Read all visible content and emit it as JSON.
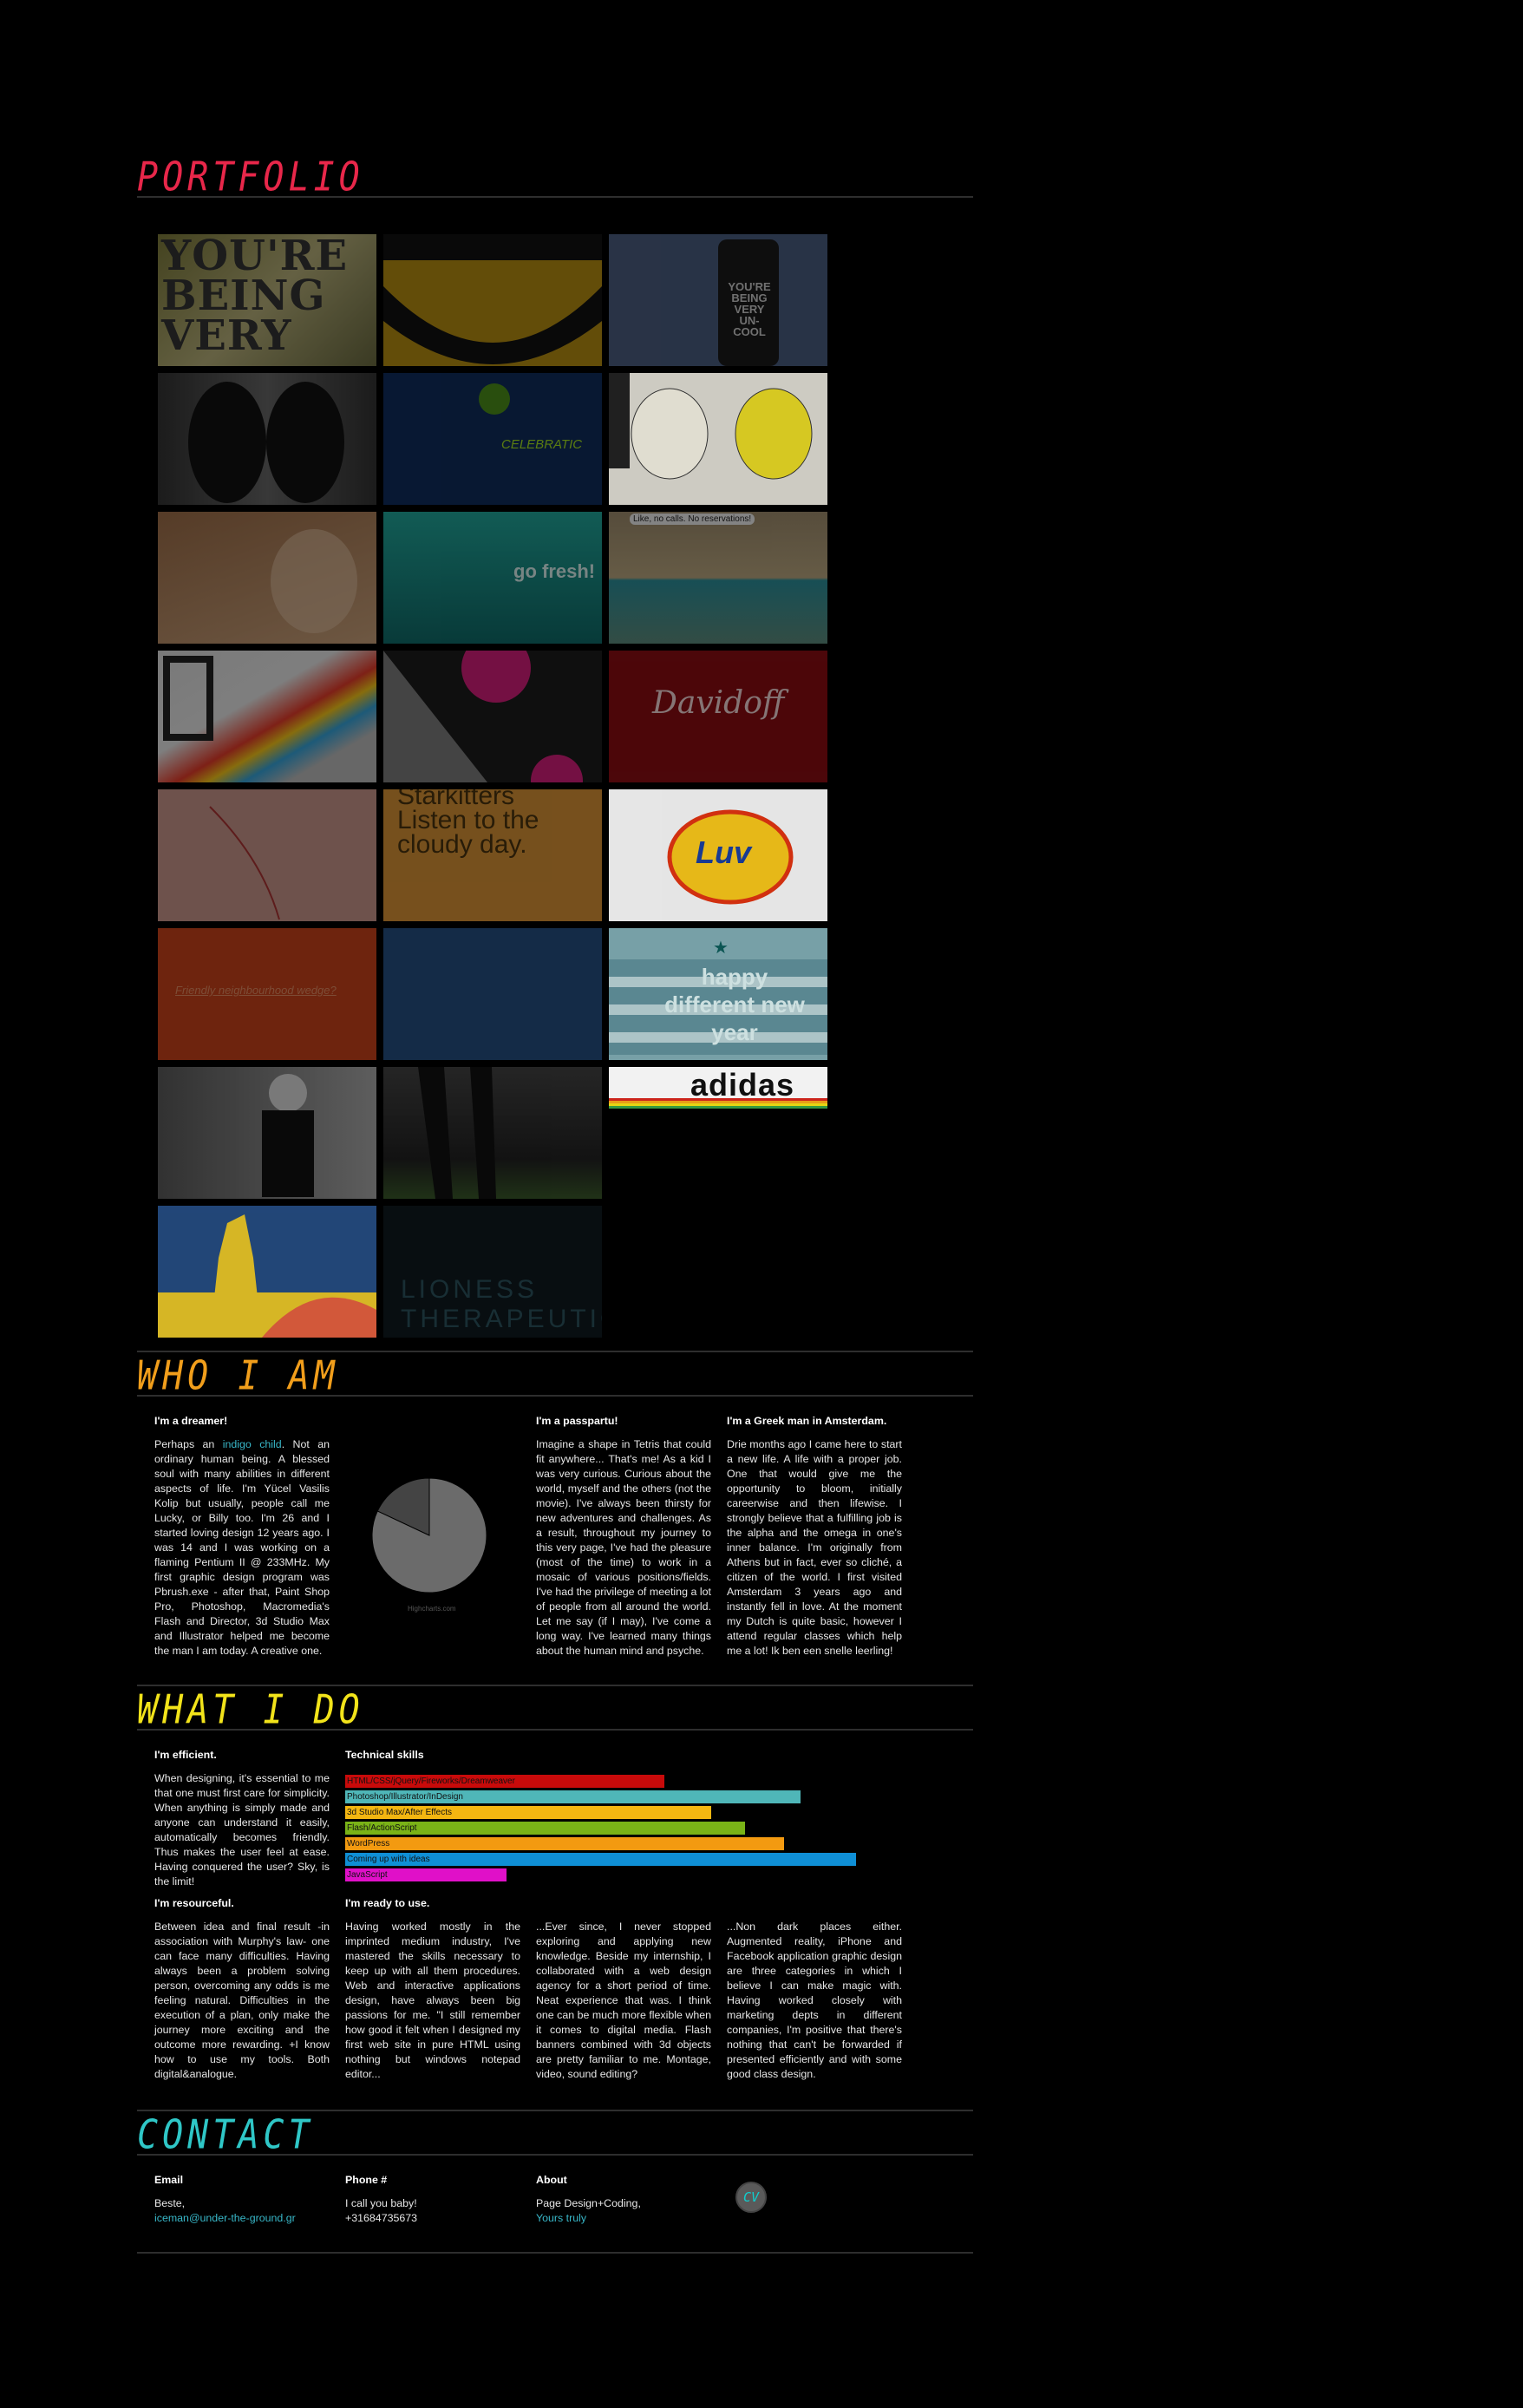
{
  "sections": {
    "portfolio": {
      "title": "PORTFOLIO",
      "color": "#e8274a"
    },
    "who": {
      "title": "WHO I AM",
      "color": "#f19e1b"
    },
    "what": {
      "title": "WHAT I DO",
      "color": "#f2e31a"
    },
    "contact": {
      "title": "CONTACT",
      "color": "#2fc7c7"
    }
  },
  "portfolio_tiles": [
    {
      "caption": "YOU'RE BEING VERY"
    },
    {
      "caption": ""
    },
    {
      "caption": "YOU'RE BEING VERY UN-COOL"
    },
    {
      "caption": ""
    },
    {
      "caption": "CELEBRATIC"
    },
    {
      "caption": ""
    },
    {
      "caption": ""
    },
    {
      "caption": "go fresh!"
    },
    {
      "caption": "Like, no calls. No reservations!"
    },
    {
      "caption": ""
    },
    {
      "caption": ""
    },
    {
      "caption": "Davidoff"
    },
    {
      "caption": ""
    },
    {
      "caption": "Starkitters Listen to the cloudy day."
    },
    {
      "caption": "Luv"
    },
    {
      "caption": "Friendly neighbourhood wedge?"
    },
    {
      "caption": ""
    },
    {
      "caption": "happy different new year"
    },
    {
      "caption": ""
    },
    {
      "caption": ""
    },
    {
      "caption": ""
    },
    {
      "caption": "LIONESS THERAPEUTICS"
    },
    {
      "caption": "adidas"
    }
  ],
  "who": {
    "col1": {
      "heading": "I'm a dreamer!",
      "pre": "Perhaps an ",
      "link": "indigo child",
      "body": ". Not an ordinary human being. A blessed soul with many abilities in different aspects of life. I'm Yücel Vasilis Kolip but usually, people call me Lucky, or Billy too. I'm 26 and I started loving design 12 years ago. I was 14 and I was working on a flaming Pentium II @ 233MHz. My first graphic design program was Pbrush.exe - after that, Paint Shop Pro, Photoshop, Macromedia's Flash and Director, 3d Studio Max and Illustrator helped me become the man I am today. A creative one."
    },
    "chart_credit": "Highcharts.com",
    "col3": {
      "heading": "I'm a passpartu!",
      "body": "Imagine a shape in Tetris that could fit anywhere... That's me! As a kid I was very curious. Curious about the world, myself and the others (not the movie). I've always been thirsty for new adventures and challenges. As a result, throughout my journey to this very page, I've had the pleasure (most of the time) to work in a mosaic of various positions/fields. I've had the privilege of meeting a lot of people from all around the world. Let me say (if I may), I've come a long way. I've learned many things about the human mind and psyche."
    },
    "col4": {
      "heading": "I'm a Greek man in Amsterdam.",
      "body": "Drie months ago I came here to start a new life. A life with a proper job. One that would give me the opportunity to bloom, initially careerwise and then lifewise. I strongly believe that a fulfilling job is the alpha and the omega in one's inner balance. I'm originally from Athens but in fact, ever so cliché, a citizen of the world. I first visited Amsterdam 3 years ago and instantly fell in love. At the moment my Dutch is quite basic, however I attend regular classes which help me a lot! Ik ben een snelle leerling!"
    }
  },
  "chart_data": {
    "type": "pie",
    "title": "",
    "slices": [
      {
        "name": "",
        "value": 82,
        "color": "#6b6b6b"
      },
      {
        "name": "",
        "value": 18,
        "color": "#444444"
      }
    ]
  },
  "what": {
    "efficient": {
      "heading": "I'm efficient.",
      "body": "When designing, it's essential to me that one must first care for simplicity. When anything is simply made and anyone can understand it easily, automatically becomes friendly. Thus makes the user feel at ease. Having conquered the user? Sky, is the limit!"
    },
    "skills_heading": "Technical skills",
    "skills": [
      {
        "label": "HTML/CSS/jQuery/Fireworks/Dreamweaver",
        "level": 0.575,
        "color": "#c80a0a"
      },
      {
        "label": "Photoshop/Illustrator/InDesign",
        "level": 0.82,
        "color": "#4fb6b8"
      },
      {
        "label": "3d Studio Max/After Effects",
        "level": 0.66,
        "color": "#f3b611"
      },
      {
        "label": "Flash/ActionScript",
        "level": 0.72,
        "color": "#7ab317"
      },
      {
        "label": "WordPress",
        "level": 0.79,
        "color": "#f39a10"
      },
      {
        "label": "Coming up with ideas",
        "level": 0.92,
        "color": "#0f8fd6"
      },
      {
        "label": "JavaScript",
        "level": 0.29,
        "color": "#e010c8"
      }
    ],
    "resourceful": {
      "heading": "I'm resourceful.",
      "body": "Between idea and final result -in association with Murphy's law- one can face many difficulties. Having always been a problem solving person, overcoming any odds is me feeling natural. Difficulties in the execution of a plan, only make the journey more exciting and the outcome more rewarding. +I know how to use my tools. Both digital&analogue."
    },
    "ready": {
      "heading": "I'm ready to use.",
      "body": "Having worked mostly in the imprinted medium industry, I've mastered the skills necessary to keep up with all them procedures. Web and interactive applications design, have always been big passions for me. \"I still remember how good it felt when I designed my first web site in pure HTML using nothing but windows notepad editor..."
    },
    "col3": {
      "body": "...Ever since, I never stopped exploring and applying new knowledge. Beside my internship, I collaborated with a web design agency for a short period of time. Neat experience that was. I think one can be much more flexible when it comes to digital media. Flash banners combined with 3d objects are pretty familiar to me. Montage, video, sound editing?"
    },
    "col4": {
      "body": "...Non dark places either. Augmented reality, iPhone and Facebook application graphic design are three categories in which I believe I can make magic with. Having worked closely with marketing depts in different companies, I'm positive that there's nothing that can't be forwarded if presented efficiently and with some good class design."
    }
  },
  "contact": {
    "email": {
      "heading": "Email",
      "line1": "Beste,",
      "link": "iceman@under-the-ground.gr"
    },
    "phone": {
      "heading": "Phone #",
      "line1": "I call you baby!",
      "line2": "+31684735673"
    },
    "about": {
      "heading": "About",
      "line1": "Page Design+Coding,",
      "link": "Yours truly"
    },
    "cv_label": "CV"
  }
}
